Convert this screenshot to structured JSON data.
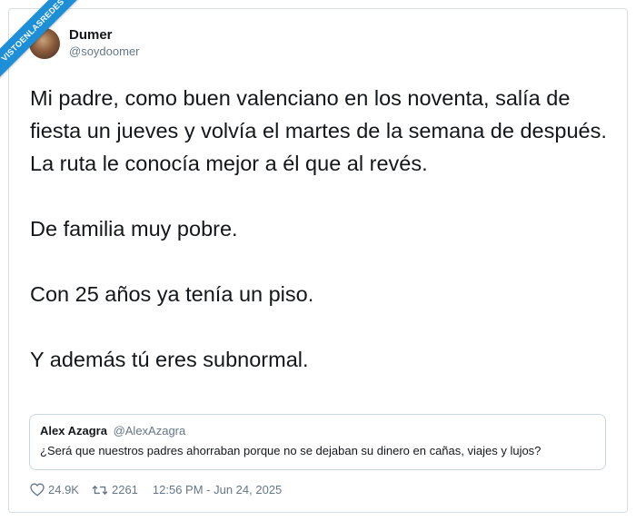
{
  "watermark": {
    "text": "VISTOENLASREDES"
  },
  "tweet": {
    "author": {
      "display_name": "Dumer",
      "handle": "@soydoomer"
    },
    "paragraphs": [
      "Mi padre, como buen valenciano en los noventa, salía de fiesta un jueves y volvía el martes de la semana de después. La ruta le conocía mejor a él que al revés.",
      "De familia muy pobre.",
      "Con 25 años ya tenía un piso.",
      "Y además tú eres subnormal."
    ],
    "quoted": {
      "display_name": "Alex Azagra",
      "handle": "@AlexAzagra",
      "text": "¿Será que nuestros padres ahorraban porque no se dejaban su dinero en cañas, viajes y lujos?"
    },
    "stats": {
      "likes": "24.9K",
      "retweets": "2261",
      "timestamp": "12:56 PM - Jun 24, 2025"
    }
  },
  "colors": {
    "accent": "#1d8fd8",
    "secondary_text": "#657786",
    "border": "#ccd6dd"
  }
}
